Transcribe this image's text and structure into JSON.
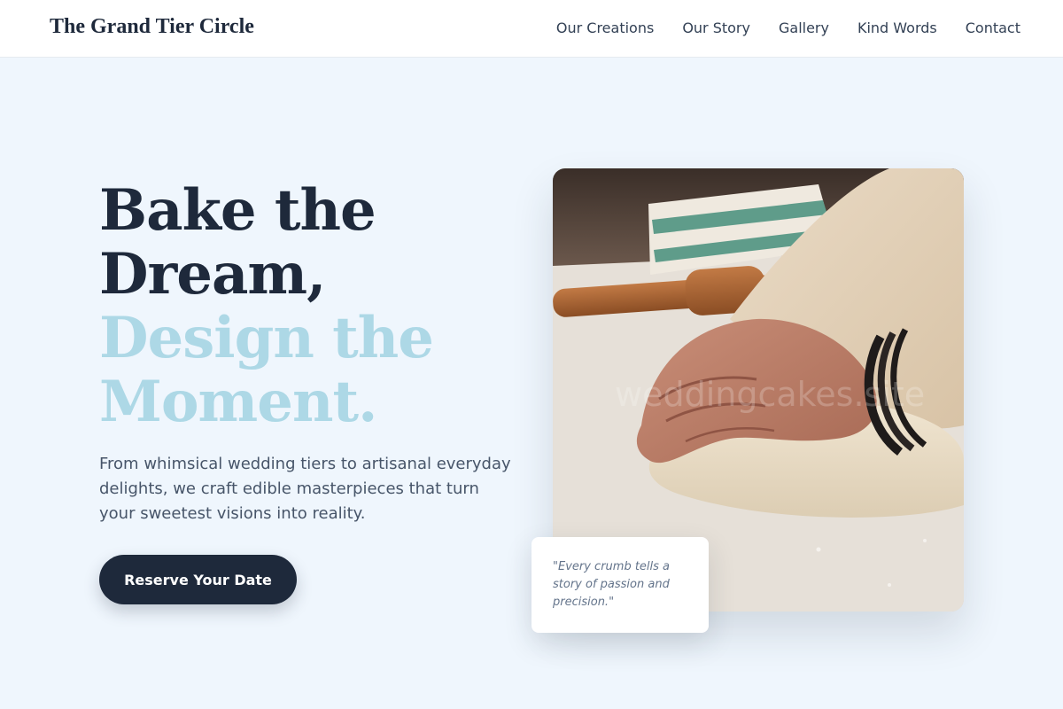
{
  "brand": {
    "name": "The Grand Tier Circle"
  },
  "nav": {
    "items": [
      {
        "label": "Our Creations"
      },
      {
        "label": "Our Story"
      },
      {
        "label": "Gallery"
      },
      {
        "label": "Kind Words"
      },
      {
        "label": "Contact"
      }
    ]
  },
  "hero": {
    "title_line1": "Bake the",
    "title_line2": "Dream,",
    "title_line3": "Design the",
    "title_line4": "Moment.",
    "subtitle": "From whimsical wedding tiers to artisanal everyday delights, we craft edible masterpieces that turn your sweetest visions into reality.",
    "cta_label": "Reserve Your Date",
    "watermark": "weddingcakes.site"
  },
  "quote": {
    "text": "\"Every crumb tells a story of passion and precision.\""
  },
  "colors": {
    "page_background": "#eff6fd",
    "header_background": "#ffffff",
    "dark_navy": "#1e293b",
    "accent_light_blue": "#add8e6",
    "body_text": "#475569"
  },
  "icons": {
    "hero_image": "dough-kneading-photo"
  }
}
